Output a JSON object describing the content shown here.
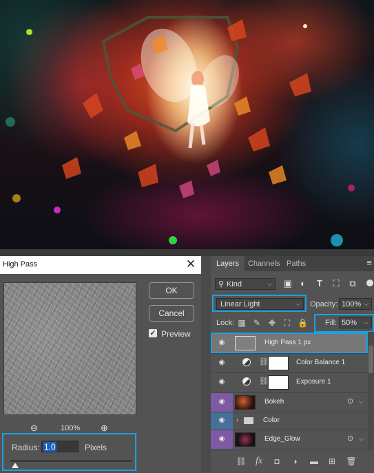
{
  "image": {
    "description_name": "fairy-autumn-leaves-photo"
  },
  "dialog": {
    "title": "High Pass",
    "close_glyph": "✕",
    "ok_label": "OK",
    "cancel_label": "Cancel",
    "preview_label": "Preview",
    "preview_checked": true,
    "zoom_level": "100%",
    "zoom_out_glyph": "⊖",
    "zoom_in_glyph": "⊕",
    "radius_label": "Radius:",
    "radius_value": "1.0",
    "radius_unit": "Pixels"
  },
  "layers_panel": {
    "tabs": [
      {
        "label": "Layers",
        "active": true
      },
      {
        "label": "Channels",
        "active": false
      },
      {
        "label": "Paths",
        "active": false
      }
    ],
    "filter_kind": "Kind",
    "blend_mode": "Linear Light",
    "opacity_label": "Opacity:",
    "opacity_value": "100%",
    "lock_label": "Lock:",
    "fill_label": "Fill:",
    "fill_value": "50%",
    "layers": [
      {
        "name": "High Pass 1 px",
        "selected": true,
        "type": "pixel",
        "tag": "none"
      },
      {
        "name": "Color Balance 1",
        "selected": false,
        "type": "adjustment",
        "tag": "none"
      },
      {
        "name": "Exposure 1",
        "selected": false,
        "type": "adjustment",
        "tag": "none"
      },
      {
        "name": "Bokeh",
        "selected": false,
        "type": "smart",
        "tag": "purple"
      },
      {
        "name": "Color",
        "selected": false,
        "type": "group",
        "tag": "blue"
      },
      {
        "name": "Edge_Glow",
        "selected": false,
        "type": "smart",
        "tag": "purple"
      }
    ]
  },
  "colors": {
    "highlight": "#1ba1e2",
    "panel_bg": "#535353",
    "selected_row": "#777777",
    "tag_purple": "#7d5aa3",
    "tag_blue": "#46709a"
  }
}
